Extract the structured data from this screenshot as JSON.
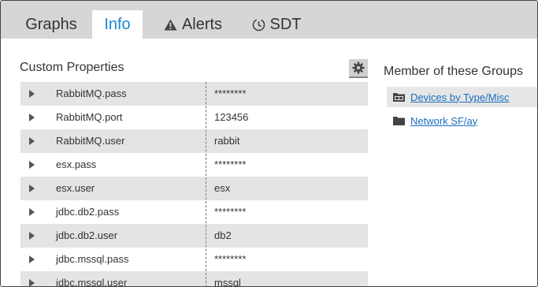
{
  "tabs": [
    {
      "label": "Graphs",
      "icon": null,
      "active": false
    },
    {
      "label": "Info",
      "icon": null,
      "active": true
    },
    {
      "label": "Alerts",
      "icon": "warning-icon",
      "active": false
    },
    {
      "label": "SDT",
      "icon": "clock-icon",
      "active": false
    }
  ],
  "custom_properties": {
    "title": "Custom Properties",
    "settings_icon": "gear-icon",
    "rows": [
      {
        "name": "RabbitMQ.pass",
        "value": "********"
      },
      {
        "name": "RabbitMQ.port",
        "value": "123456"
      },
      {
        "name": "RabbitMQ.user",
        "value": "rabbit"
      },
      {
        "name": "esx.pass",
        "value": "********"
      },
      {
        "name": "esx.user",
        "value": "esx"
      },
      {
        "name": "jdbc.db2.pass",
        "value": "********"
      },
      {
        "name": "jdbc.db2.user",
        "value": "db2"
      },
      {
        "name": "jdbc.mssql.pass",
        "value": "********"
      },
      {
        "name": "jdbc.mssql.user",
        "value": "mssql"
      }
    ]
  },
  "groups": {
    "title": "Member of these Groups",
    "items": [
      {
        "label": "Devices by Type/Misc",
        "icon": "device-folder-icon"
      },
      {
        "label": "Network SF/ay",
        "icon": "folder-icon"
      }
    ]
  },
  "colors": {
    "accent": "#1a88d6",
    "link": "#1a6fc0",
    "tabbar_bg": "#d6d6d6",
    "row_shade": "#e4e4e4"
  }
}
